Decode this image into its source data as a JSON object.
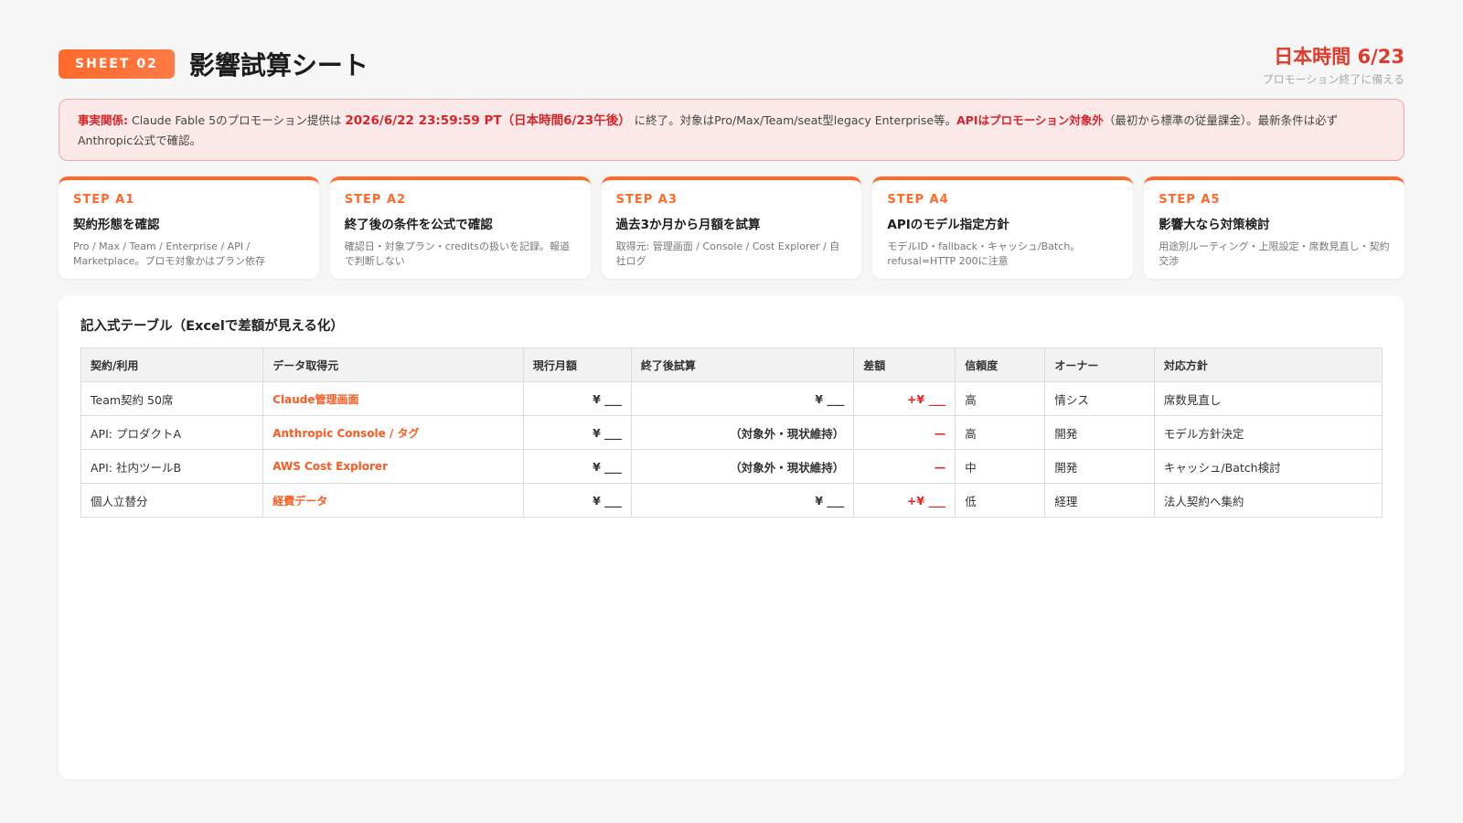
{
  "header": {
    "badge": "SHEET 02",
    "title": "影響試算シート",
    "date_main": "日本時間 6/23",
    "date_sub": "プロモーション終了に備える"
  },
  "alert": {
    "label": "事実関係:",
    "text1": " Claude Fable 5のプロモーション提供は ",
    "deadline": "2026/6/22 23:59:59 PT（日本時間6/23午後）",
    "text2": " に終了。対象はPro/Max/Team/seat型legacy Enterprise等。",
    "api_note": "APIはプロモーション対象外",
    "text3": "（最初から標準の従量課金）。最新条件は必ずAnthropic公式で確認。"
  },
  "steps": [
    {
      "label": "STEP A1",
      "title": "契約形態を確認",
      "desc": "Pro / Max / Team / Enterprise / API / Marketplace。プロモ対象かはプラン依存"
    },
    {
      "label": "STEP A2",
      "title": "終了後の条件を公式で確認",
      "desc": "確認日・対象プラン・creditsの扱いを記録。報道で判断しない"
    },
    {
      "label": "STEP A3",
      "title": "過去3か月から月額を試算",
      "desc": "取得元: 管理画面 / Console / Cost Explorer / 自社ログ"
    },
    {
      "label": "STEP A4",
      "title": "APIのモデル指定方針",
      "desc": "モデルID・fallback・キャッシュ/Batch。refusal=HTTP 200に注意"
    },
    {
      "label": "STEP A5",
      "title": "影響大なら対策検討",
      "desc": "用途別ルーティング・上限設定・席数見直し・契約交渉"
    }
  ],
  "table": {
    "title": "記入式テーブル（Excelで差額が見える化）",
    "headers": [
      "契約/利用",
      "データ取得元",
      "現行月額",
      "終了後試算",
      "差額",
      "信頼度",
      "オーナー",
      "対応方針"
    ],
    "rows": [
      [
        "Team契約 50席",
        "Claude管理画面",
        "¥ ___",
        "¥ ___",
        "+¥ ___",
        "高",
        "情シス",
        "席数見直し"
      ],
      [
        "API: プロダクトA",
        "Anthropic Console / タグ",
        "¥ ___",
        "（対象外・現状維持）",
        "—",
        "高",
        "開発",
        "モデル方針決定"
      ],
      [
        "API: 社内ツールB",
        "AWS Cost Explorer",
        "¥ ___",
        "（対象外・現状維持）",
        "—",
        "中",
        "開発",
        "キャッシュ/Batch検討"
      ],
      [
        "個人立替分",
        "経費データ",
        "¥ ___",
        "¥ ___",
        "+¥ ___",
        "低",
        "経理",
        "法人契約へ集約"
      ]
    ]
  },
  "colors": {
    "accent": "#ff6a2b",
    "alert_red": "#d8252a",
    "alert_bg": "#fbe9ea"
  }
}
